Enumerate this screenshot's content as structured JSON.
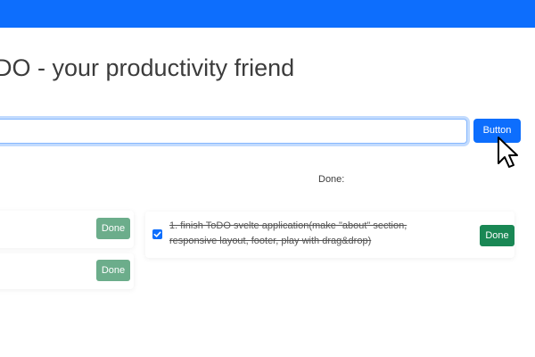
{
  "header": {
    "title": "DO - your productivity friend"
  },
  "new_todo": {
    "input_value": "",
    "button_label": "Button"
  },
  "columns": {
    "done_heading": "Done:"
  },
  "todo_items": [
    {
      "done_button_label": "Done"
    },
    {
      "done_button_label": "Done"
    }
  ],
  "done_items": [
    {
      "text": "1. finish ToDO svelte application(make \"about\" section, responsive layout, footer, play with drag&drop)",
      "checked": true,
      "done_button_label": "Done"
    }
  ],
  "colors": {
    "accent": "#0d6efd",
    "success": "#198754",
    "success_faded": "#6cad8b"
  },
  "icons": {
    "checkbox": "check-icon",
    "pointer": "mouse-pointer-icon"
  }
}
